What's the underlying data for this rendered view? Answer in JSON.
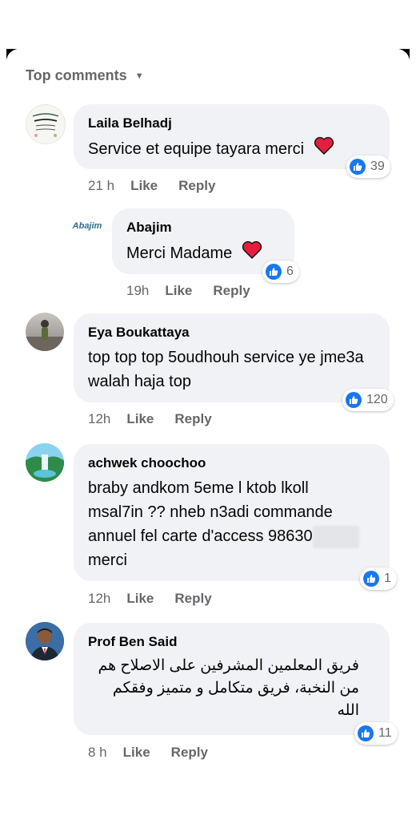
{
  "header": {
    "title": "Top comments"
  },
  "comments": [
    {
      "author": "Laila Belhadj",
      "text": "Service et equipe tayara merci",
      "reactions": "39",
      "time": "21 h",
      "like": "Like",
      "reply": "Reply"
    },
    {
      "author": "Abajim",
      "avatar_text": "Abajim",
      "text": "Merci Madame",
      "reactions": "6",
      "time": "19h",
      "like": "Like",
      "reply": "Reply"
    },
    {
      "author": "Eya Boukattaya",
      "text": "top top top 5oudhouh service ye jme3a walah haja top",
      "reactions": "120",
      "time": "12h",
      "like": "Like",
      "reply": "Reply"
    },
    {
      "author": "achwek choochoo",
      "text_line1": "braby andkom 5eme l ktob lkoll",
      "text_line2": "msal7in ?? nheb n3adi commande",
      "text_line3": "annuel fel carte d'access 98630",
      "text_line4": "merci",
      "reactions": "1",
      "time": "12h",
      "like": "Like",
      "reply": "Reply"
    },
    {
      "author": "Prof Ben Said",
      "text": "فريق المعلمين المشرفين على الاصلاح هم من النخبة، فريق متكامل و متميز وفقكم الله",
      "reactions": "11",
      "time": "8 h",
      "like": "Like",
      "reply": "Reply"
    }
  ],
  "colors": {
    "like_blue": "#1877f2",
    "bubble": "#f0f2f5",
    "secondary_text": "#65676b",
    "heart_red": "#e41e3f"
  }
}
